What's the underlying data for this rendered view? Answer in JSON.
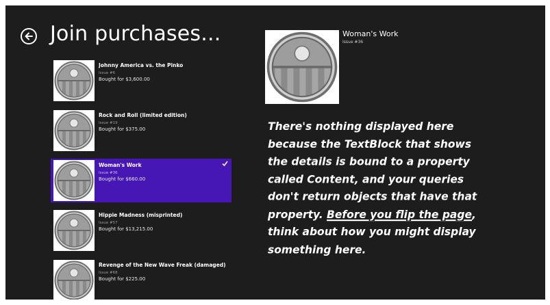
{
  "page": {
    "title": "Join purchases...",
    "back_icon": "back-arrow-circle-icon"
  },
  "purchases": [
    {
      "title": "Johnny America vs. the Pinko",
      "issue": "Issue #6",
      "bought": "Bought for $3,600.00",
      "selected": false
    },
    {
      "title": "Rock and Roll (limited edition)",
      "issue": "Issue #19",
      "bought": "Bought for $375.00",
      "selected": false
    },
    {
      "title": "Woman's Work",
      "issue": "Issue #36",
      "bought": "Bought for $660.00",
      "selected": true
    },
    {
      "title": "Hippie Madness (misprinted)",
      "issue": "Issue #57",
      "bought": "Bought for $13,215.00",
      "selected": false
    },
    {
      "title": "Revenge of the New Wave Freak (damaged)",
      "issue": "Issue #68",
      "bought": "Bought for $225.00",
      "selected": false
    }
  ],
  "detail": {
    "title": "Woman's Work",
    "issue": "Issue #36"
  },
  "annotation": {
    "lines": [
      "There's nothing displayed here",
      "because the TextBlock that shows",
      "the details is bound to a property",
      "called Content, and your queries",
      "don't return objects that have that"
    ],
    "line6_pre": "property. ",
    "line6_underlined": "Before you flip the page",
    "line6_post": ",",
    "line7": "think about how you might display",
    "line8": "something here."
  },
  "colors": {
    "background": "#1d1d1d",
    "selection": "#4617b4",
    "text": "#ffffff"
  }
}
